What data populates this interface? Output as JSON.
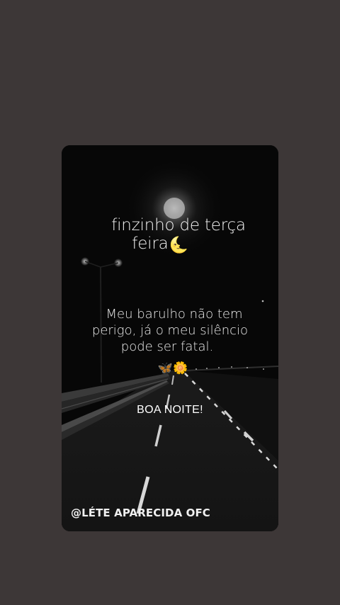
{
  "post": {
    "title_line1": "finzinho de terça",
    "title_line2": "feira",
    "title_icon": "🌜",
    "quote_line1": "Meu barulho não tem",
    "quote_line2": "perigo, já o meu silêncio",
    "quote_line3": "pode ser fatal.",
    "emoji1": "🦋",
    "emoji2": "🌼",
    "greeting": "BOA NOITE!",
    "handle": "@LÉTE APARECIDA OFC"
  },
  "icons": {
    "moon": "crescent-moon-icon",
    "butterfly": "butterfly-icon",
    "flower": "flower-icon"
  },
  "colors": {
    "page_background": "#3d3737",
    "card_background": "#070707",
    "text": "#f2f2f2"
  }
}
